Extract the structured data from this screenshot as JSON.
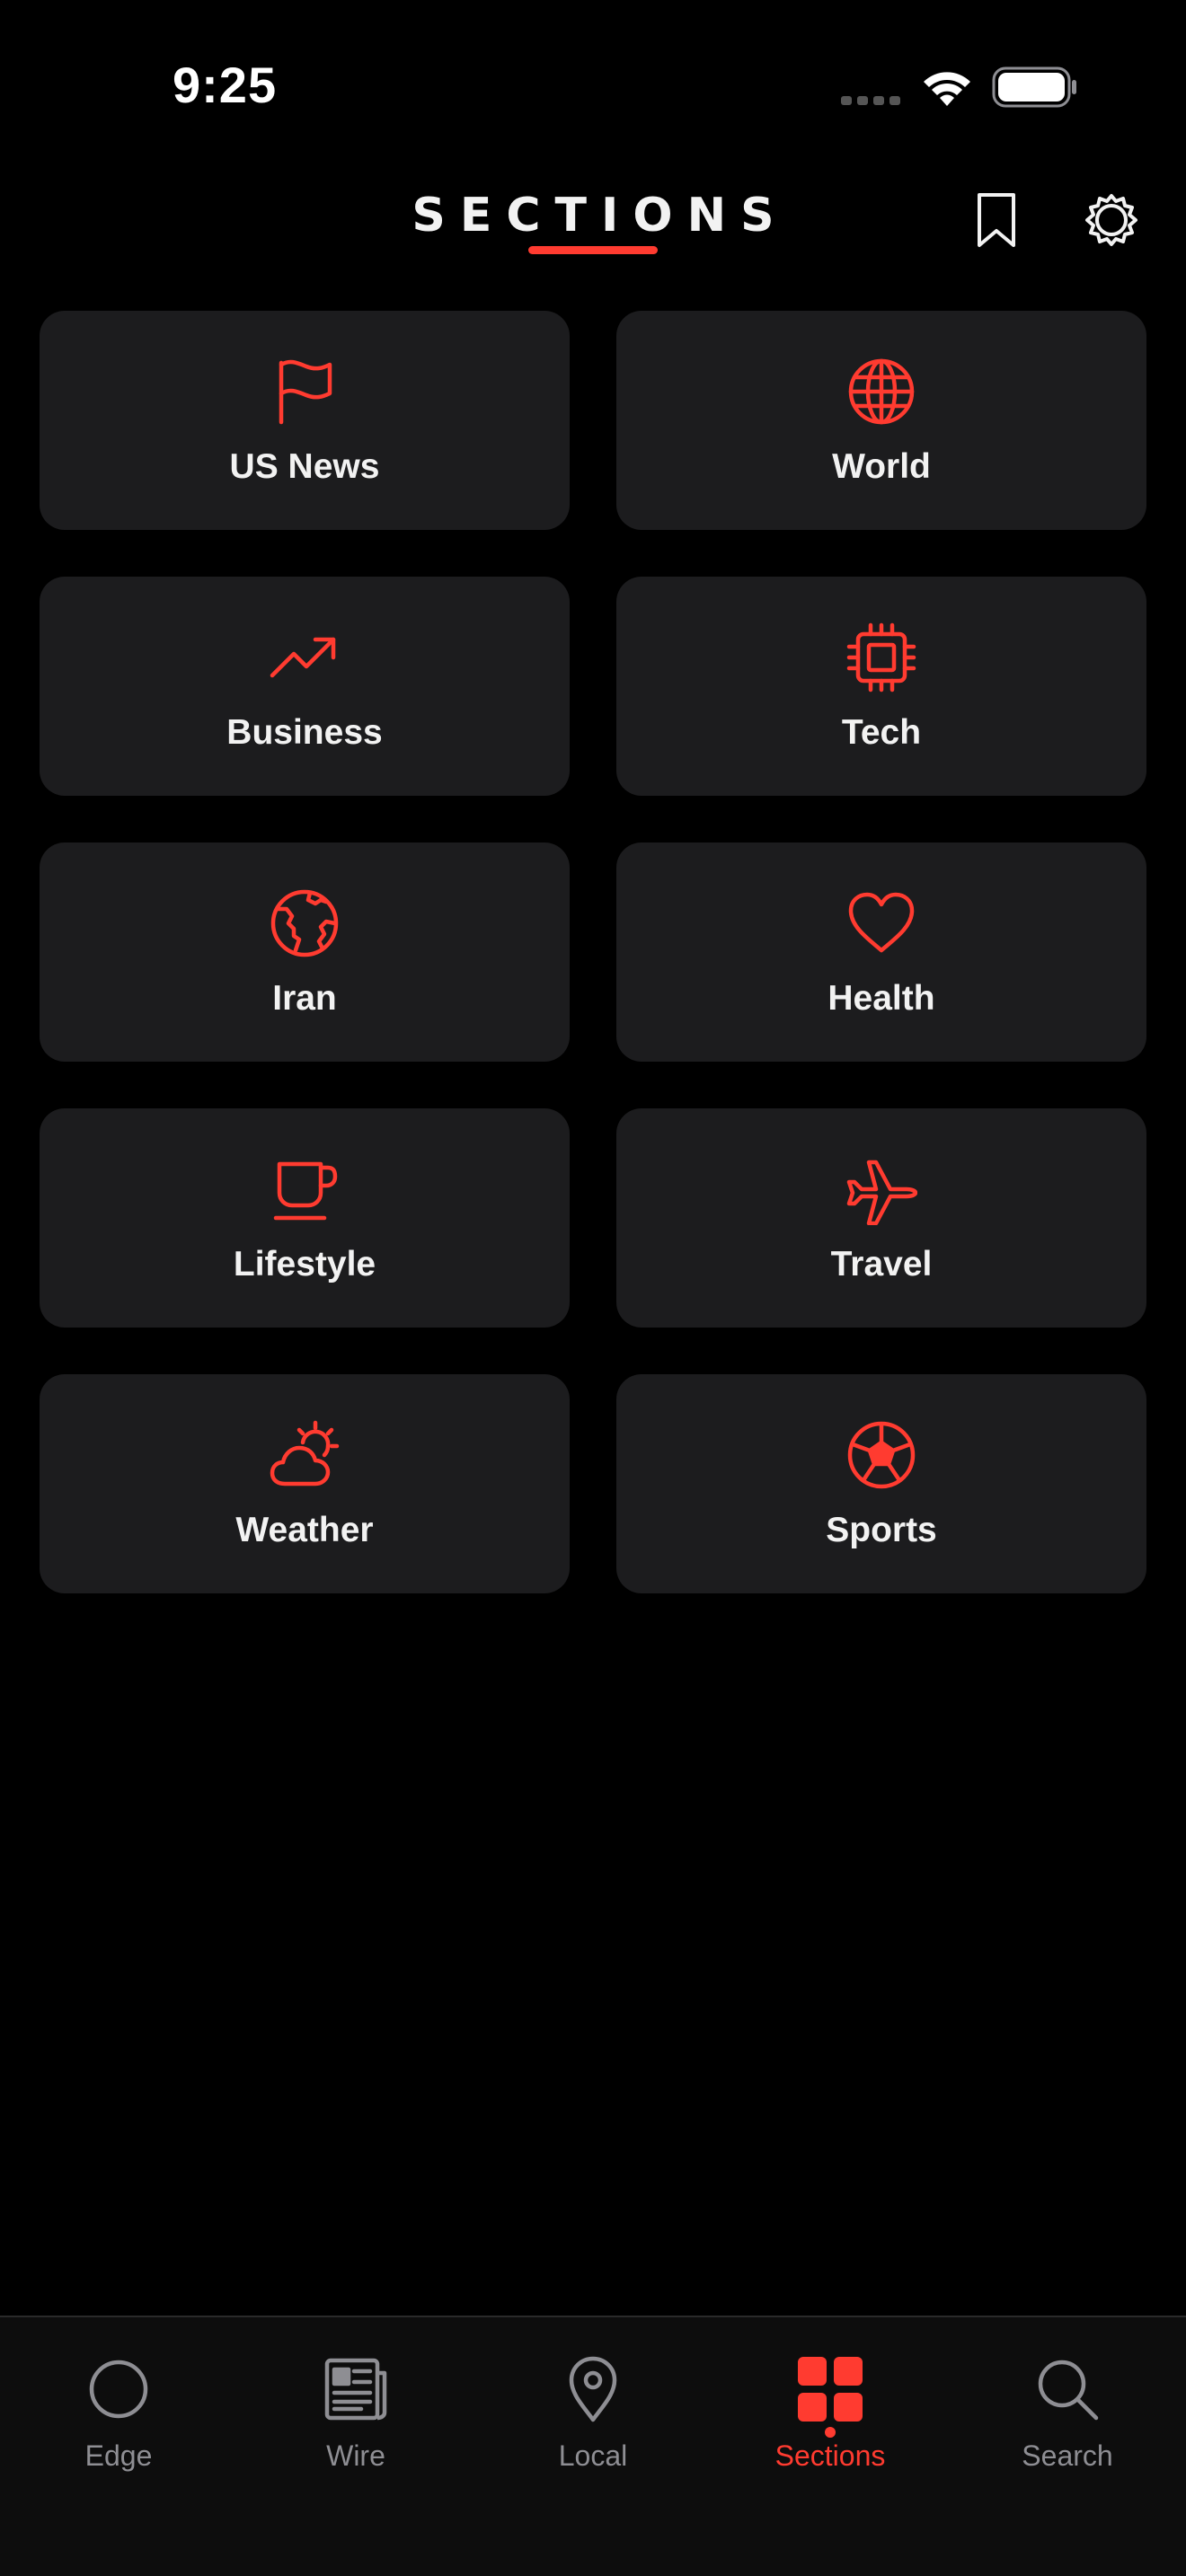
{
  "status_bar": {
    "time": "9:25"
  },
  "header": {
    "title": "SECTIONS"
  },
  "accent_color": "#ff3b30",
  "sections": [
    {
      "label": "US News",
      "icon": "flag-icon"
    },
    {
      "label": "World",
      "icon": "globe-icon"
    },
    {
      "label": "Business",
      "icon": "trending-up-icon"
    },
    {
      "label": "Tech",
      "icon": "cpu-chip-icon"
    },
    {
      "label": "Iran",
      "icon": "earth-icon"
    },
    {
      "label": "Health",
      "icon": "heart-icon"
    },
    {
      "label": "Lifestyle",
      "icon": "coffee-cup-icon"
    },
    {
      "label": "Travel",
      "icon": "airplane-icon"
    },
    {
      "label": "Weather",
      "icon": "cloud-sun-icon"
    },
    {
      "label": "Sports",
      "icon": "soccer-ball-icon"
    }
  ],
  "tabs": [
    {
      "label": "Edge",
      "icon": "circle-icon"
    },
    {
      "label": "Wire",
      "icon": "newspaper-icon"
    },
    {
      "label": "Local",
      "icon": "map-pin-icon"
    },
    {
      "label": "Sections",
      "icon": "grid-icon",
      "active": true
    },
    {
      "label": "Search",
      "icon": "search-icon"
    }
  ]
}
